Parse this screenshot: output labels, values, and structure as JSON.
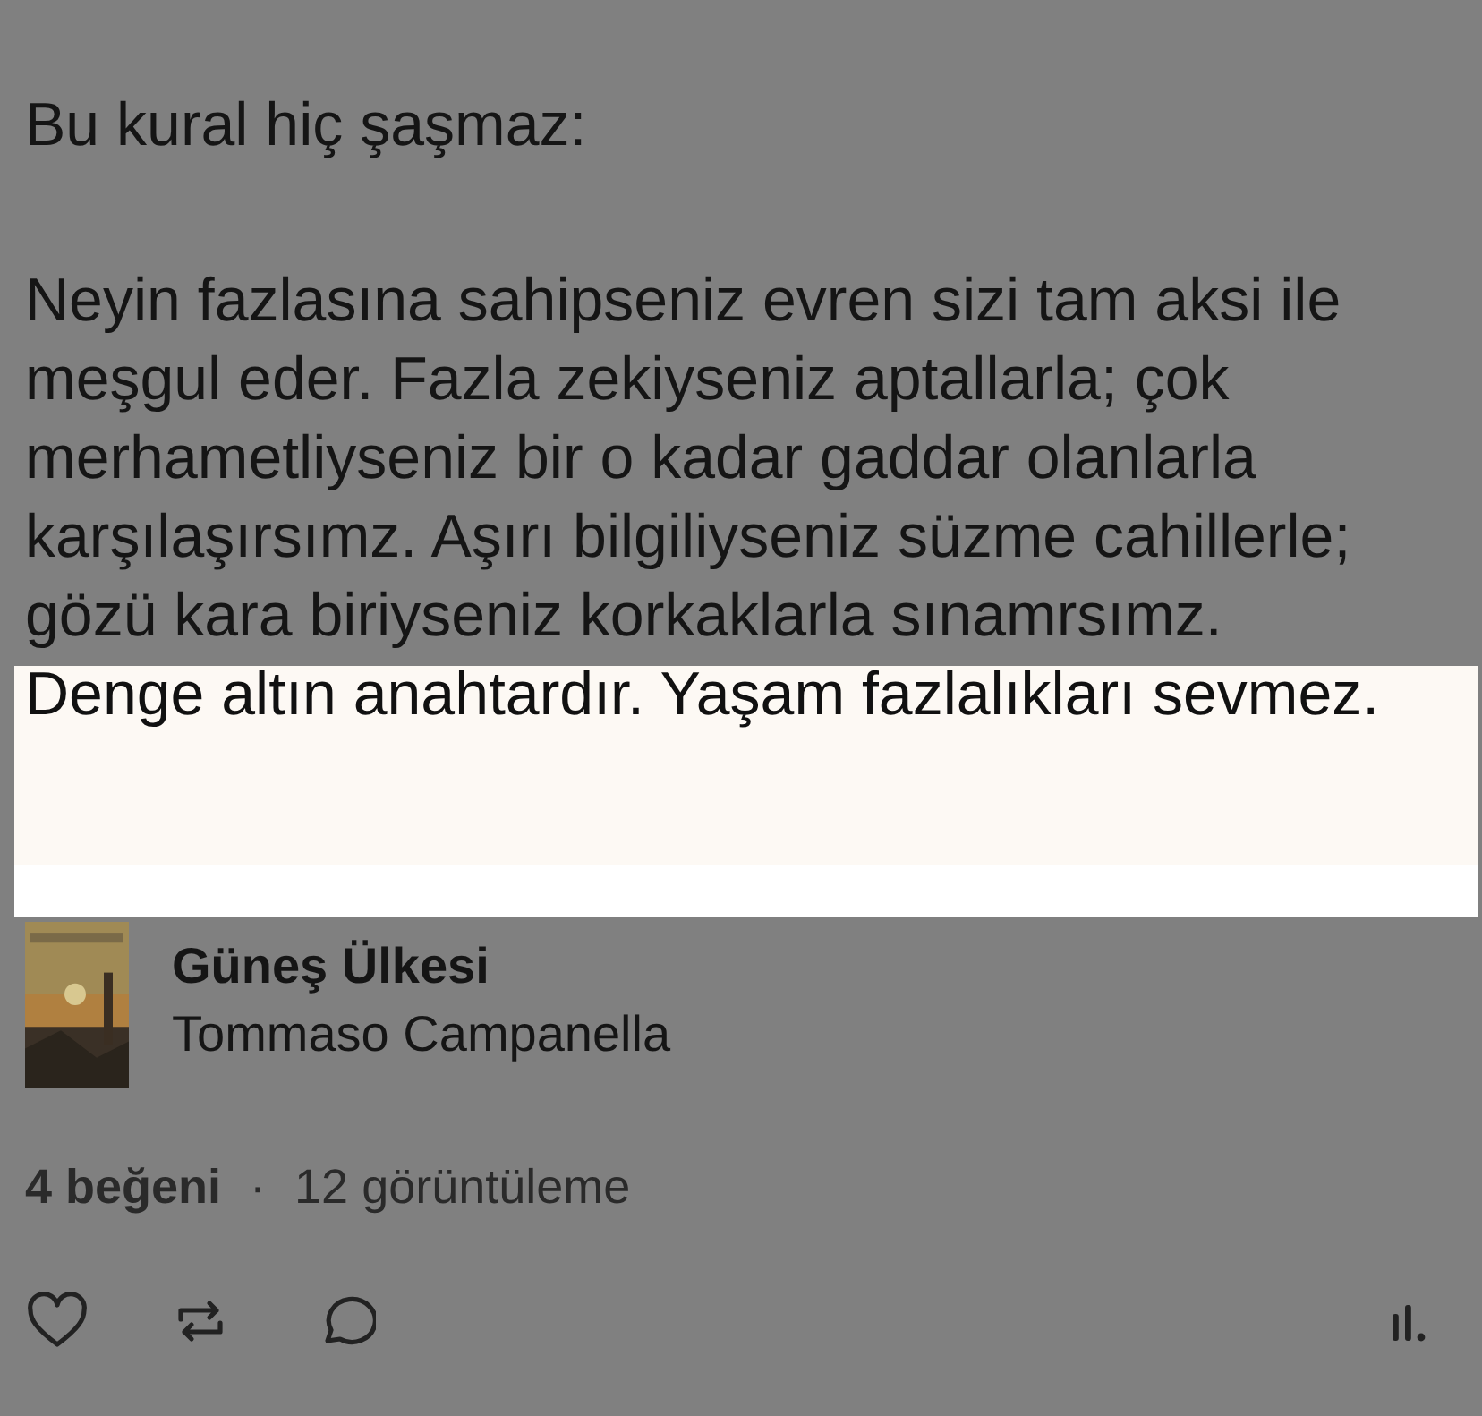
{
  "post": {
    "heading": "Bu kural hiç şaşmaz:",
    "body_lines": [
      "Neyin fazlasına sahipseniz evren sizi tam aksi ile",
      "meşgul eder. Fazla zekiyseniz aptallarla; çok",
      "merhametliyseniz bir o kadar gaddar olanlarla",
      "karşılaşırsımz. Aşırı bilgiliyseniz süzme cahillerle;",
      "gözü kara biriyseniz korkaklarla sınamrsımz."
    ],
    "highlighted": {
      "text": "Denge altın anahtardır. Yaşam fazlalıkları sevmez.",
      "selected": true
    }
  },
  "book": {
    "title": "Güneş Ülkesi",
    "author": "Tommaso Campanella"
  },
  "stats": {
    "likes": "4 beğeni",
    "separator": "·",
    "views": "12 görüntüleme"
  },
  "actions": [
    {
      "kind": "like"
    },
    {
      "kind": "repost"
    },
    {
      "kind": "comment"
    },
    {
      "kind": "insights"
    }
  ]
}
